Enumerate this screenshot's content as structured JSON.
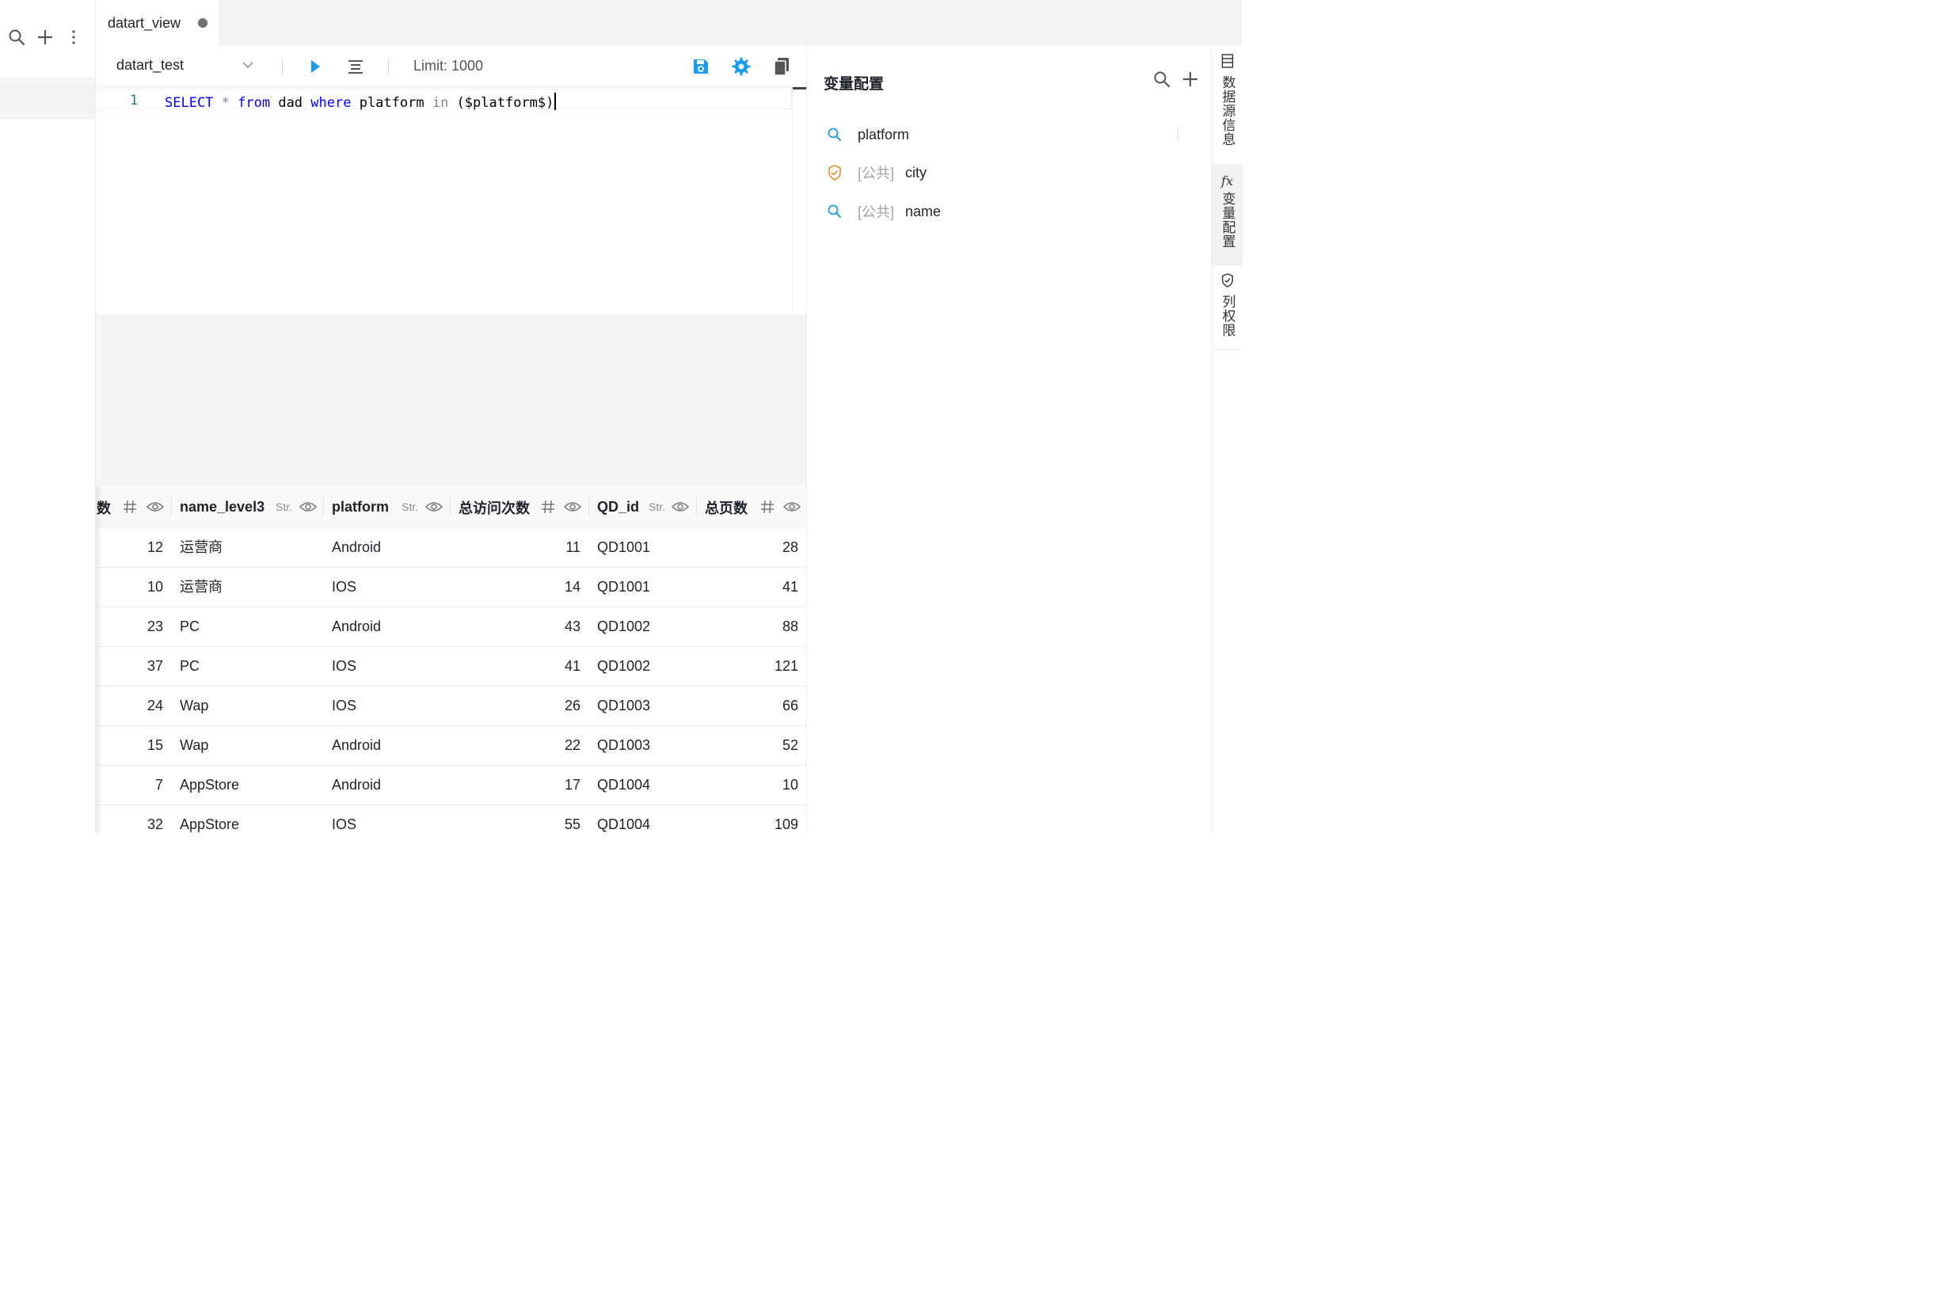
{
  "left_rail": {
    "icons": [
      "search-icon",
      "plus-icon",
      "more-vertical-icon"
    ]
  },
  "tab": {
    "title": "datart_view",
    "unsaved_dot_color": "#707070"
  },
  "toolbar": {
    "source": "datart_test",
    "limit_label": "Limit: 1000",
    "accent": "#1b9aee",
    "icons": [
      "chevron-down-icon",
      "run-icon",
      "format-icon",
      "save-icon",
      "settings-icon",
      "copy-icon"
    ]
  },
  "editor": {
    "line_number": "1",
    "tokens": {
      "select": "SELECT",
      "star": " * ",
      "from": "from",
      "table": " dad ",
      "where": "where",
      "field": " platform ",
      "in": "in",
      "rest": " ($platform$)"
    }
  },
  "table": {
    "columns": [
      {
        "label": "数",
        "type": "#"
      },
      {
        "label": "name_level3",
        "type": "Str."
      },
      {
        "label": "platform",
        "type": "Str."
      },
      {
        "label": "总访问次数",
        "type": "#"
      },
      {
        "label": "QD_id",
        "type": "Str."
      },
      {
        "label": "总页数",
        "type": "#"
      }
    ],
    "rows": [
      [
        "12",
        "运营商",
        "Android",
        "11",
        "QD1001",
        "28"
      ],
      [
        "10",
        "运营商",
        "IOS",
        "14",
        "QD1001",
        "41"
      ],
      [
        "23",
        "PC",
        "Android",
        "43",
        "QD1002",
        "88"
      ],
      [
        "37",
        "PC",
        "IOS",
        "41",
        "QD1002",
        "121"
      ],
      [
        "24",
        "Wap",
        "IOS",
        "26",
        "QD1003",
        "66"
      ],
      [
        "15",
        "Wap",
        "Android",
        "22",
        "QD1003",
        "52"
      ],
      [
        "7",
        "AppStore",
        "Android",
        "17",
        "QD1004",
        "10"
      ],
      [
        "32",
        "AppStore",
        "IOS",
        "55",
        "QD1004",
        "109"
      ]
    ]
  },
  "variables_panel": {
    "title": "变量配置",
    "items": [
      {
        "prefix": "",
        "name": "platform",
        "icon": "search-icon"
      },
      {
        "prefix": "[公共]",
        "name": "city",
        "icon": "shield-check-icon"
      },
      {
        "prefix": "[公共]",
        "name": "name",
        "icon": "search-icon"
      }
    ]
  },
  "side_tabs": [
    {
      "label": "数据源信息",
      "icon": "table-icon"
    },
    {
      "label": "变量配置",
      "icon": "fx-icon",
      "fx": "fx",
      "active": true
    },
    {
      "label": "列权限",
      "icon": "shield-icon"
    }
  ]
}
